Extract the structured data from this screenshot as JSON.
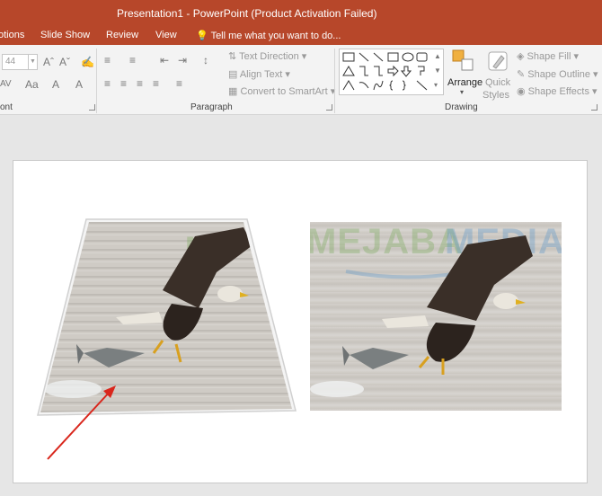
{
  "titlebar": {
    "title": "Presentation1 - PowerPoint (Product Activation Failed)"
  },
  "tabs": [
    {
      "label": "otions"
    },
    {
      "label": "Slide Show"
    },
    {
      "label": "Review"
    },
    {
      "label": "View"
    }
  ],
  "tellme": {
    "text": "Tell me what you want to do..."
  },
  "font": {
    "size": "44",
    "group_label": "ont"
  },
  "paragraph": {
    "text_direction": "Text Direction",
    "align_text": "Align Text",
    "convert_smartart": "Convert to SmartArt",
    "group_label": "Paragraph"
  },
  "drawing": {
    "arrange": "Arrange",
    "quick": "Quick",
    "styles": "Styles",
    "shape_fill": "Shape Fill",
    "shape_outline": "Shape Outline",
    "shape_effects": "Shape Effects",
    "group_label": "Drawing"
  },
  "slide": {
    "watermark_part1": "MEJABA",
    "watermark_part2": "MEDIA"
  },
  "colors": {
    "accent": "#b7472a",
    "annotation_arrow": "#d9261c"
  },
  "icons": [
    "lightbulb-icon",
    "arrange-icon",
    "quick-styles-icon",
    "shape-fill-icon",
    "shape-outline-icon",
    "shape-effects-icon",
    "annotation-arrow"
  ]
}
